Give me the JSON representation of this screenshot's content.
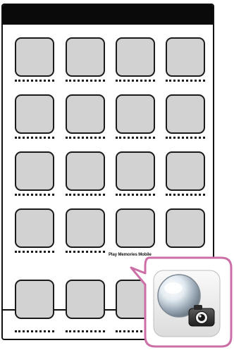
{
  "screen": {
    "status_bar_color": "#0a0a0a",
    "icon_fill_color": "#d2d2d2",
    "callout_border_color": "#cc6fa7"
  },
  "apps": {
    "grid": [
      {
        "row": 1,
        "label": "placeholder-dotted"
      },
      {
        "row": 2,
        "label": "placeholder-dotted"
      },
      {
        "row": 3,
        "label": "placeholder-dotted"
      },
      {
        "row": 4,
        "label": "placeholder-dotted"
      }
    ],
    "highlighted_app_label": "Play Memories Mobile"
  },
  "callout": {
    "icon": "playmemories-camera-icon"
  }
}
